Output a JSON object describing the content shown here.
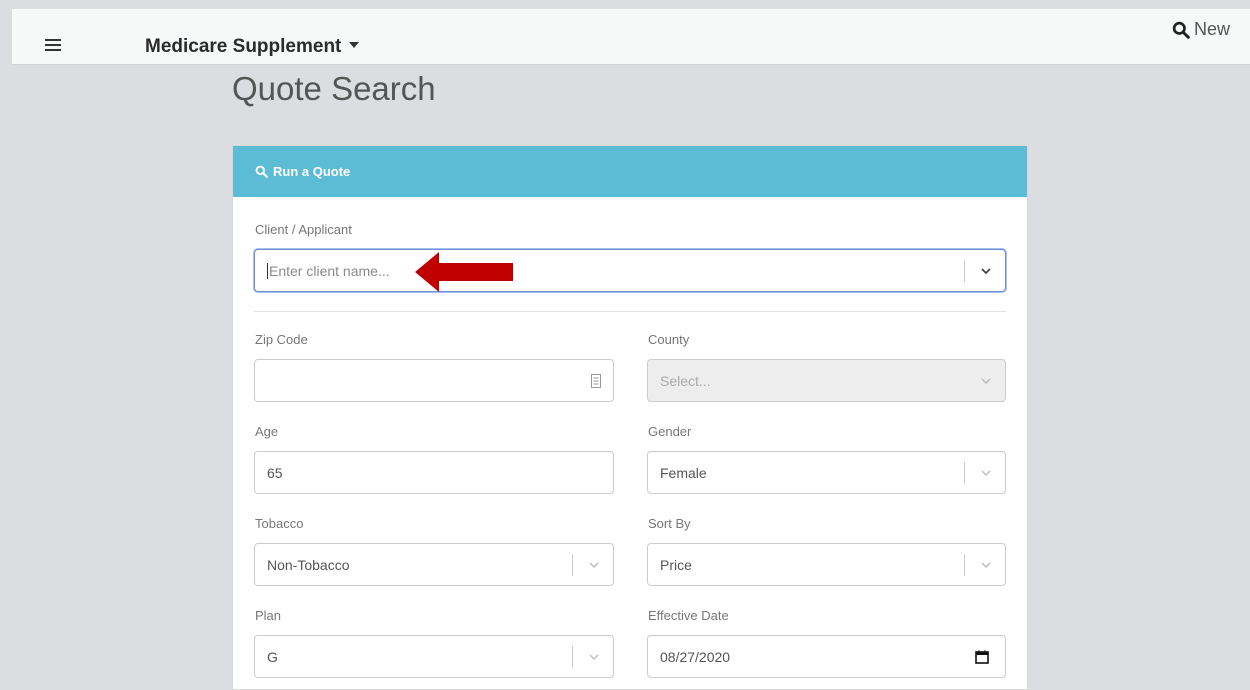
{
  "topbar": {
    "menu_icon": "hamburger-icon",
    "app_title": "Medicare Supplement",
    "new_label": "New"
  },
  "page": {
    "title": "Quote Search"
  },
  "panel": {
    "header_label": "Run a Quote",
    "header_icon": "search-icon"
  },
  "form": {
    "client": {
      "label": "Client / Applicant",
      "placeholder": "Enter client name..."
    },
    "zip": {
      "label": "Zip Code",
      "value": ""
    },
    "county": {
      "label": "County",
      "placeholder": "Select..."
    },
    "age": {
      "label": "Age",
      "value": "65"
    },
    "gender": {
      "label": "Gender",
      "value": "Female"
    },
    "tobacco": {
      "label": "Tobacco",
      "value": "Non-Tobacco"
    },
    "sort_by": {
      "label": "Sort By",
      "value": "Price"
    },
    "plan": {
      "label": "Plan",
      "value": "G"
    },
    "effective_date": {
      "label": "Effective Date",
      "value": "08/27/2020"
    }
  },
  "colors": {
    "header_bg": "#5cbcd6",
    "page_bg": "#dcdde0",
    "annotation_arrow": "#c00000"
  }
}
